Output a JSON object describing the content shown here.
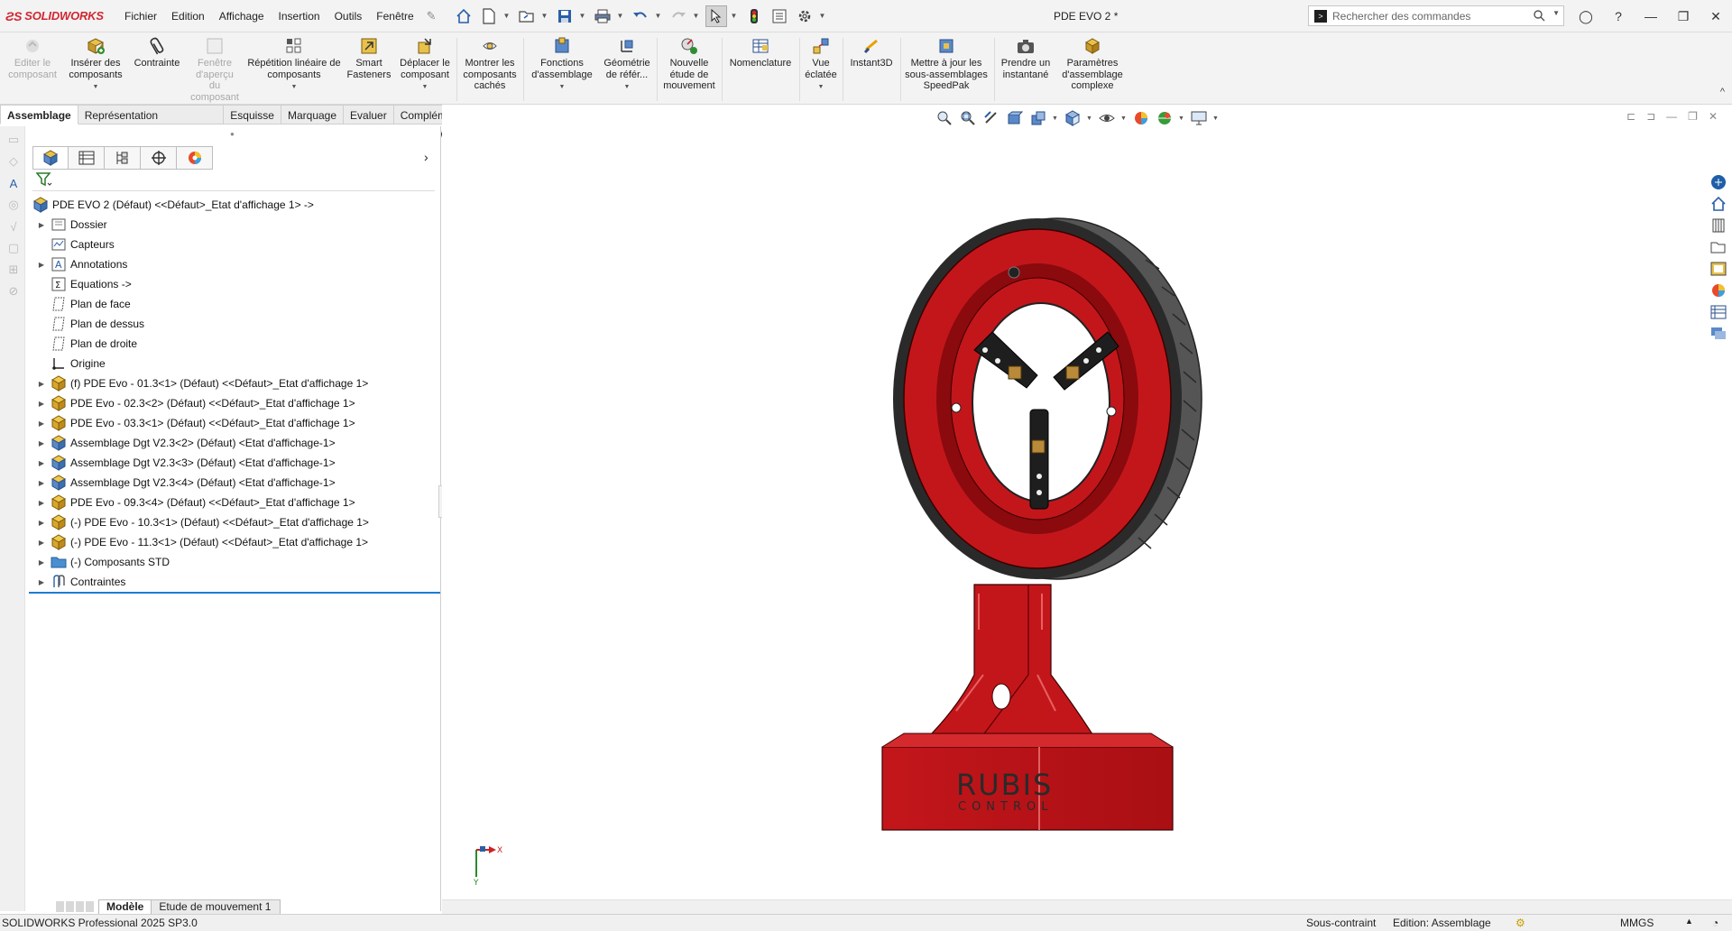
{
  "app": {
    "name": "SOLIDWORKS",
    "document_title": "PDE EVO 2 *"
  },
  "menu": [
    "Fichier",
    "Edition",
    "Affichage",
    "Insertion",
    "Outils",
    "Fenêtre"
  ],
  "search": {
    "placeholder": "Rechercher des commandes"
  },
  "ribbon": {
    "buttons": [
      {
        "label": "Editer le composant",
        "enabled": false
      },
      {
        "label": "Insérer des composants",
        "enabled": true
      },
      {
        "label": "Contrainte",
        "enabled": true
      },
      {
        "label": "Fenêtre d'aperçu du composant",
        "enabled": false
      },
      {
        "label": "Répétition linéaire de composants",
        "enabled": true
      },
      {
        "label": "Smart Fasteners",
        "enabled": true
      },
      {
        "label": "Déplacer le composant",
        "enabled": true
      },
      {
        "label": "Montrer les composants cachés",
        "enabled": true
      },
      {
        "label": "Fonctions d'assemblage",
        "enabled": true
      },
      {
        "label": "Géométrie de référ...",
        "enabled": true
      },
      {
        "label": "Nouvelle étude de mouvement",
        "enabled": true
      },
      {
        "label": "Nomenclature",
        "enabled": true
      },
      {
        "label": "Vue éclatée",
        "enabled": true
      },
      {
        "label": "Instant3D",
        "enabled": true
      },
      {
        "label": "Mettre à jour les sous-assemblages SpeedPak",
        "enabled": true
      },
      {
        "label": "Prendre un instantané",
        "enabled": true
      },
      {
        "label": "Paramètres d'assemblage complexe",
        "enabled": true
      }
    ]
  },
  "command_tabs": [
    "Assemblage",
    "Représentation schématique",
    "Esquisse",
    "Marquage",
    "Evaluer",
    "Compléments de SOLIDWORKS"
  ],
  "active_command_tab": "Assemblage",
  "feature_tree": {
    "root": "PDE EVO 2 (Défaut) <<Défaut>_Etat d'affichage 1> ->",
    "items": [
      {
        "label": "Dossier",
        "icon": "folder-icon",
        "expandable": true
      },
      {
        "label": "Capteurs",
        "icon": "sensor-icon",
        "expandable": false
      },
      {
        "label": "Annotations",
        "icon": "annotations-icon",
        "expandable": true
      },
      {
        "label": "Equations ->",
        "icon": "equations-icon",
        "expandable": false
      },
      {
        "label": "Plan de face",
        "icon": "plane-icon",
        "expandable": false
      },
      {
        "label": "Plan de dessus",
        "icon": "plane-icon",
        "expandable": false
      },
      {
        "label": "Plan de droite",
        "icon": "plane-icon",
        "expandable": false
      },
      {
        "label": "Origine",
        "icon": "origin-icon",
        "expandable": false
      },
      {
        "label": "(f) PDE Evo - 01.3<1> (Défaut) <<Défaut>_Etat d'affichage 1>",
        "icon": "subassembly-icon",
        "expandable": true
      },
      {
        "label": "PDE Evo - 02.3<2> (Défaut) <<Défaut>_Etat d'affichage 1>",
        "icon": "subassembly-icon",
        "expandable": true
      },
      {
        "label": "PDE Evo - 03.3<1> (Défaut) <<Défaut>_Etat d'affichage 1>",
        "icon": "subassembly-icon",
        "expandable": true
      },
      {
        "label": "Assemblage Dgt V2.3<2> (Défaut) <Etat d'affichage-1>",
        "icon": "assembly-icon",
        "expandable": true
      },
      {
        "label": "Assemblage Dgt V2.3<3> (Défaut) <Etat d'affichage-1>",
        "icon": "assembly-icon",
        "expandable": true
      },
      {
        "label": "Assemblage Dgt V2.3<4> (Défaut) <Etat d'affichage-1>",
        "icon": "assembly-icon",
        "expandable": true
      },
      {
        "label": "PDE Evo - 09.3<4> (Défaut) <<Défaut>_Etat d'affichage 1>",
        "icon": "subassembly-icon",
        "expandable": true
      },
      {
        "label": "(-) PDE Evo - 10.3<1> (Défaut) <<Défaut>_Etat d'affichage 1>",
        "icon": "subassembly-icon",
        "expandable": true
      },
      {
        "label": "(-) PDE Evo - 11.3<1> (Défaut) <<Défaut>_Etat d'affichage 1>",
        "icon": "subassembly-icon",
        "expandable": true
      },
      {
        "label": "(-) Composants STD",
        "icon": "blue-folder-icon",
        "expandable": true
      },
      {
        "label": "Contraintes",
        "icon": "mates-icon",
        "expandable": true
      }
    ]
  },
  "bottom_tabs": [
    "Modèle",
    "Etude de mouvement 1"
  ],
  "active_bottom_tab": "Modèle",
  "status": {
    "version": "SOLIDWORKS Professional 2025 SP3.0",
    "constraint": "Sous-contraint",
    "mode": "Edition: Assemblage",
    "units": "MMGS"
  },
  "model": {
    "logo_line1": "RUBIS",
    "logo_line2": "CONTROL"
  },
  "triad": {
    "x": "X",
    "y": "Y"
  },
  "colors": {
    "brand": "#d22630",
    "part_red": "#c8181c",
    "tree_highlight": "#1d7bd6"
  }
}
